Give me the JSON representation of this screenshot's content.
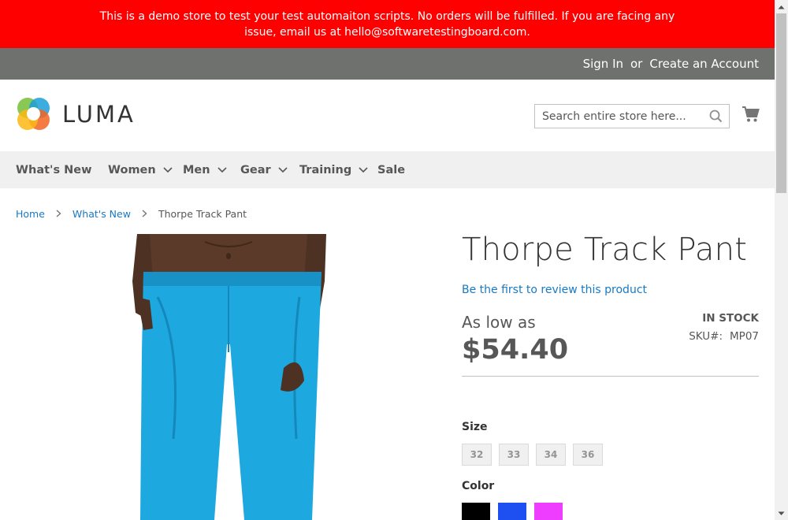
{
  "demo_banner": {
    "text": "This is a demo store to test your test automaiton scripts. No orders will be fulfilled. If you are facing any issue, email us at hello@softwaretestingboard.com."
  },
  "header": {
    "sign_in": "Sign In",
    "or": "or",
    "create_account": "Create an Account",
    "logo_text": "LUMA",
    "search_placeholder": "Search entire store here..."
  },
  "nav": {
    "items": [
      {
        "label": "What's New",
        "has_dropdown": false
      },
      {
        "label": "Women",
        "has_dropdown": true
      },
      {
        "label": "Men",
        "has_dropdown": true
      },
      {
        "label": "Gear",
        "has_dropdown": true
      },
      {
        "label": "Training",
        "has_dropdown": true
      },
      {
        "label": "Sale",
        "has_dropdown": false
      }
    ]
  },
  "breadcrumb": [
    "Home",
    "What's New",
    "Thorpe Track Pant"
  ],
  "product": {
    "title": "Thorpe Track Pant",
    "review_link": "Be the first to review this product",
    "price_prefix": "As low as",
    "price": "$54.40",
    "stock": "In stock",
    "sku_label": "SKU#:",
    "sku": "MP07",
    "size_label": "Size",
    "sizes": [
      "32",
      "33",
      "34",
      "36"
    ],
    "color_label": "Color",
    "colors": [
      "#000000",
      "#1e4ff0",
      "#ef3dff"
    ]
  },
  "colors": {
    "banner_bg": "#ff0000",
    "panel_bg": "#6e716e",
    "nav_bg": "#f0f0f0",
    "link": "#1979c3",
    "pants": "#1ea8e0"
  }
}
